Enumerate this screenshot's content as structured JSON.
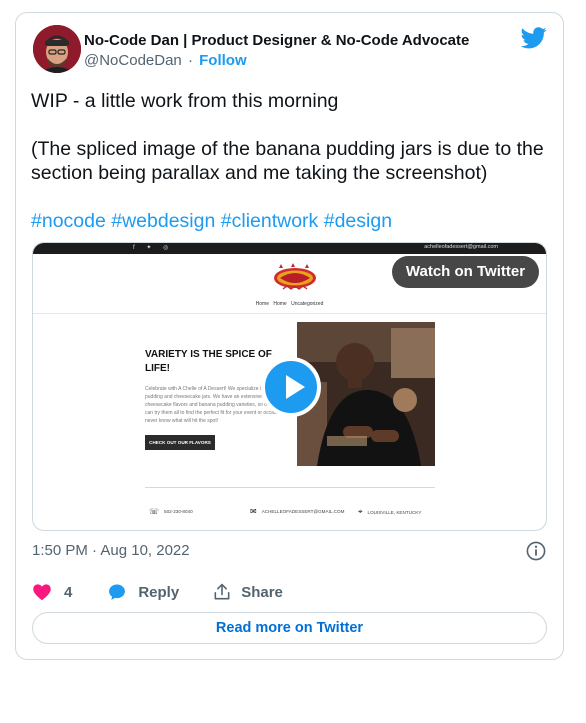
{
  "author": {
    "name": "No-Code Dan | Product Designer & No-Code Advocate",
    "handle": "@NoCodeDan",
    "separator": "·",
    "follow_label": "Follow"
  },
  "tweet": {
    "line1": "WIP - a little work from this morning",
    "line2": "(The spliced image of the banana pudding jars is due to the section being parallax and me taking the screenshot)",
    "hashtags": [
      "#nocode",
      "#webdesign",
      "#clientwork",
      "#design"
    ]
  },
  "media": {
    "watch_label": "Watch on Twitter",
    "site": {
      "topbar_social": "f ✦ ◎",
      "topbar_email": "achelleofadessert@gmail.com",
      "nav": [
        "Home",
        "Home",
        "Uncategorized"
      ],
      "hero_title": "VARIETY IS THE SPICE OF LIFE!",
      "hero_body": "Celebrate with A Chelle of A Dessert! We specialize in banana pudding and cheesecake jars. We have an extensive selection of cheesecake flavors and banana pudding varieties, so our customers can try them all to find the perfect fit for your event or occasion. You never know what will hit the spot!",
      "cta_label": "CHECK OUT OUR FLAVORS",
      "contact_phone": "502-230-8040",
      "contact_email": "ACHELLEOFADESSERT@GMAIL.COM",
      "contact_location": "LOUISVILLE, KENTUCKY"
    }
  },
  "meta": {
    "timestamp": "1:50 PM · Aug 10, 2022"
  },
  "actions": {
    "like_count": "4",
    "reply_label": "Reply",
    "share_label": "Share",
    "read_more_label": "Read more on Twitter"
  },
  "colors": {
    "accent": "#1d9bf0",
    "like": "#f91880",
    "link": "#006fd6"
  }
}
